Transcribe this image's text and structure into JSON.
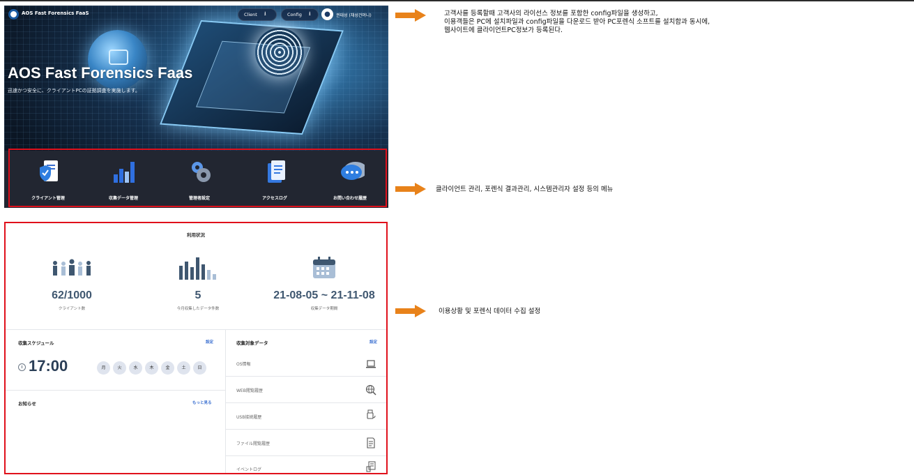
{
  "app": {
    "brand": "AOS Fast Forensics FaaS",
    "client_button": "Client",
    "config_button": "Config",
    "user_name": "권태성 (채성건머니)"
  },
  "hero": {
    "title": "AOS Fast Forensics Faas",
    "subtitle": "迅速かつ安全に、クライアントPCの証拠調査を実施します。"
  },
  "menu": {
    "items": [
      {
        "label": "クライアント管理",
        "icon": "document-shield-icon"
      },
      {
        "label": "収集データ管理",
        "icon": "bar-chart-icon"
      },
      {
        "label": "管理者設定",
        "icon": "gears-icon"
      },
      {
        "label": "アクセスログ",
        "icon": "log-document-icon"
      },
      {
        "label": "お問い合わせ履歴",
        "icon": "chat-bubble-icon"
      }
    ]
  },
  "usage": {
    "title": "利用状況",
    "stats": [
      {
        "value": "62/1000",
        "label": "クライアント数",
        "icon": "people-icon"
      },
      {
        "value": "5",
        "label": "今月収集したデータ件数",
        "icon": "bars-icon"
      },
      {
        "value": "21-08-05 ~ 21-11-08",
        "label": "収集データ期間",
        "icon": "calendar-icon"
      }
    ]
  },
  "schedule": {
    "title": "収集スケジュール",
    "link": "設定",
    "time": "17:00",
    "days": [
      "月",
      "火",
      "水",
      "木",
      "金",
      "土",
      "日"
    ]
  },
  "notice": {
    "title": "お知らせ",
    "link": "もっと見る"
  },
  "targets": {
    "title": "収集対象データ",
    "link": "設定",
    "rows": [
      {
        "label": "OS情報",
        "icon": "laptop-icon"
      },
      {
        "label": "WEB閲覧履歴",
        "icon": "globe-search-icon"
      },
      {
        "label": "USB接続履歴",
        "icon": "usb-icon"
      },
      {
        "label": "ファイル閲覧履歴",
        "icon": "file-icon"
      },
      {
        "label": "イベントログ",
        "icon": "event-log-icon"
      }
    ]
  },
  "annotations": {
    "note1_line1": "고객사를 등록할때 고객사의 라이선스 정보를 포함한 config파일을 생성하고,",
    "note1_line2": "이용객들은 PC에 설치파일과 config파일을 다운로드 받아 PC포렌식 소프트를 설치함과 동시에,",
    "note1_line3": "웹사이트에 클라이언트PC정보가 등록된다.",
    "note2": "클라이언트 관리, 포렌식 결과관리, 시스템관리자 설정 등의 메뉴",
    "note3": "이용상황 및 포렌식 데이터 수집 설정"
  },
  "colors": {
    "annotation_arrow": "#e8821a",
    "highlight_box": "#e0101b",
    "accent_blue": "#3a6fd0"
  }
}
